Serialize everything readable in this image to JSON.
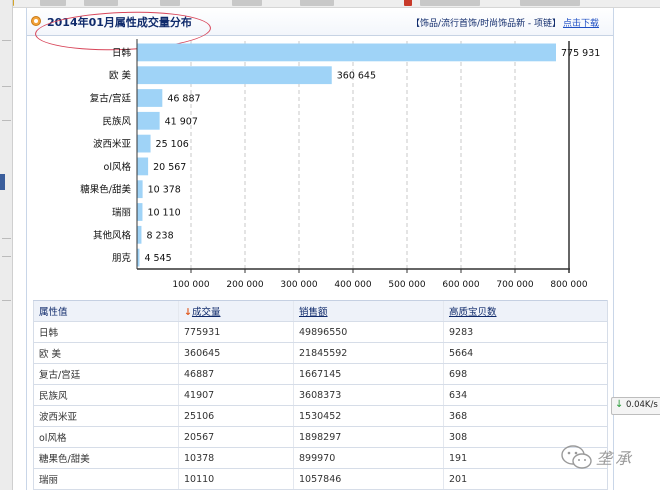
{
  "header": {
    "title": "2014年01月属性成交量分布",
    "breadcrumb": "【饰品/流行首饰/时尚饰品新 - 项链】",
    "download_label": "点击下载"
  },
  "chart_data": {
    "type": "bar",
    "orientation": "horizontal",
    "title": "",
    "xlabel": "",
    "ylabel": "",
    "categories": [
      "日韩",
      "欧 美",
      "复古/宫廷",
      "民族风",
      "波西米亚",
      "ol风格",
      "糖果色/甜美",
      "瑞丽",
      "其他风格",
      "朋克"
    ],
    "values": [
      775931,
      360645,
      46887,
      41907,
      25106,
      20567,
      10378,
      10110,
      8238,
      4545
    ],
    "value_labels": [
      "775 931",
      "360 645",
      "46 887",
      "41 907",
      "25 106",
      "20 567",
      "10 378",
      "10 110",
      "8 238",
      "4 545"
    ],
    "xlim": [
      0,
      800000
    ],
    "x_ticks": [
      100000,
      200000,
      300000,
      400000,
      500000,
      600000,
      700000,
      800000
    ],
    "x_tick_labels": [
      "100 000",
      "200 000",
      "300 000",
      "400 000",
      "500 000",
      "600 000",
      "700 000",
      "800 000"
    ],
    "grid": true,
    "bar_color": "#9fd3f7"
  },
  "table": {
    "columns": [
      "属性值",
      "成交量",
      "销售额",
      "高质宝贝数"
    ],
    "sort_column_index": 1,
    "sort_icon": "sort-down-arrow-icon",
    "rows": [
      [
        "日韩",
        "775931",
        "49896550",
        "9283"
      ],
      [
        "欧 美",
        "360645",
        "21845592",
        "5664"
      ],
      [
        "复古/宫廷",
        "46887",
        "1667145",
        "698"
      ],
      [
        "民族风",
        "41907",
        "3608373",
        "634"
      ],
      [
        "波西米亚",
        "25106",
        "1530452",
        "368"
      ],
      [
        "ol风格",
        "20567",
        "1898297",
        "308"
      ],
      [
        "糖果色/甜美",
        "10378",
        "899970",
        "191"
      ],
      [
        "瑞丽",
        "10110",
        "1057846",
        "201"
      ]
    ]
  },
  "speed_widget": {
    "value": "0.04K/s",
    "icon": "download-arrow-icon"
  },
  "watermark": {
    "text": "垄承",
    "icon": "wechat-icon"
  },
  "colors": {
    "accent": "#0f2a6b",
    "link": "#1f4fc4",
    "annotation": "#d8465a",
    "header_icon": "#f2a23a"
  }
}
